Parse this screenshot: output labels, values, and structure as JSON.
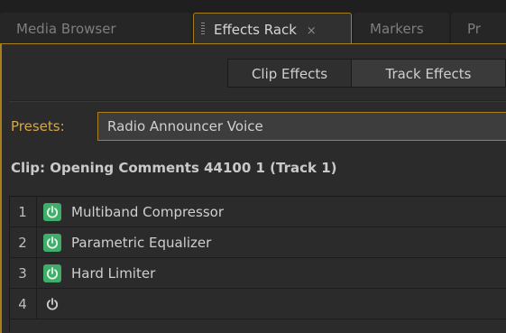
{
  "tabs": [
    {
      "label": "Media Browser",
      "active": false
    },
    {
      "label": "Effects Rack",
      "active": true,
      "closable": true
    },
    {
      "label": "Markers",
      "active": false
    },
    {
      "label": "Pr",
      "active": false
    }
  ],
  "tab_close_glyph": "×",
  "effect_tabs": {
    "clip_label": "Clip Effects",
    "track_label": "Track Effects"
  },
  "presets": {
    "label": "Presets:",
    "value": "Radio Announcer Voice"
  },
  "clip_info": "Clip: Opening Comments 44100 1 (Track 1)",
  "rack": {
    "slots": [
      {
        "number": "1",
        "power_on": true,
        "name": "Multiband Compressor"
      },
      {
        "number": "2",
        "power_on": true,
        "name": "Parametric Equalizer"
      },
      {
        "number": "3",
        "power_on": true,
        "name": "Hard Limiter"
      },
      {
        "number": "4",
        "power_on": false,
        "name": ""
      }
    ]
  },
  "colors": {
    "accent": "#a87f1e",
    "power_on": "#3fae6a",
    "presets_label": "#d4a84a"
  },
  "icons": {
    "power": "power-icon",
    "grip": "grip-icon",
    "close": "close-icon"
  }
}
